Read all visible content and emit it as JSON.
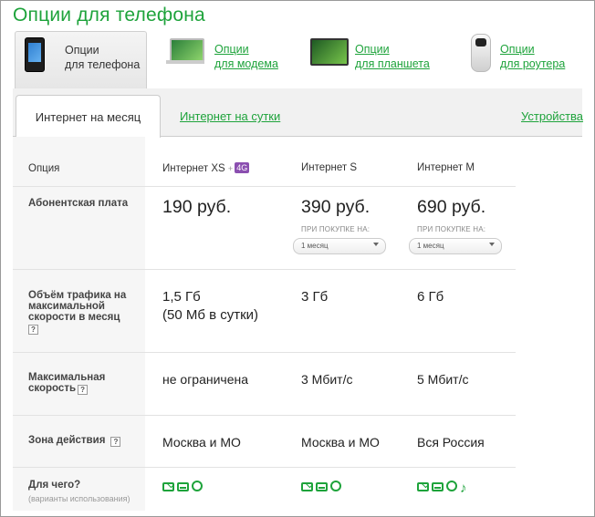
{
  "page_title": "Опции для телефона",
  "devices": [
    {
      "line1": "Опции",
      "line2": "для телефона",
      "icon": "phone-icon",
      "active": true
    },
    {
      "line1": "Опции",
      "line2": "для модема",
      "icon": "modem-icon",
      "active": false
    },
    {
      "line1": "Опции",
      "line2": "для планшета",
      "icon": "tablet-icon",
      "active": false
    },
    {
      "line1": "Опции",
      "line2": "для роутера",
      "icon": "router-icon",
      "active": false
    }
  ],
  "tabs": {
    "month": "Интернет на месяц",
    "day": "Интернет на сутки",
    "devices": "Устройства"
  },
  "table": {
    "option_header": "Опция",
    "plans": [
      {
        "name": "Интернет XS",
        "plus": "+",
        "badge": "4G",
        "price": "190 руб.",
        "traffic": "1,5 Гб",
        "traffic2": "(50 Мб в сутки)",
        "speed": "не ограничена",
        "zone": "Москва и МО"
      },
      {
        "name": "Интернет S",
        "price": "390 руб.",
        "buy_label": "ПРИ ПОКУПКЕ НА:",
        "period": "1 месяц",
        "traffic": "3 Гб",
        "speed": "3 Мбит/с",
        "zone": "Москва и МО"
      },
      {
        "name": "Интернет M",
        "price": "690 руб.",
        "buy_label": "ПРИ ПОКУПКЕ НА:",
        "period": "1 месяц",
        "traffic": "6 Гб",
        "speed": "5 Мбит/с",
        "zone": "Вся Россия"
      }
    ],
    "rows": {
      "fee": "Абонентская плата",
      "traffic_l1": "Объём трафика на",
      "traffic_l2": "максимальной",
      "traffic_l3": "скорости в месяц",
      "speed_l1": "Максимальная",
      "speed_l2": "скорость",
      "zone": "Зона действия",
      "purpose": "Для чего?",
      "purpose_sub": "(варианты использования)"
    },
    "help_glyph": "?",
    "accent": "#1ea33b"
  }
}
